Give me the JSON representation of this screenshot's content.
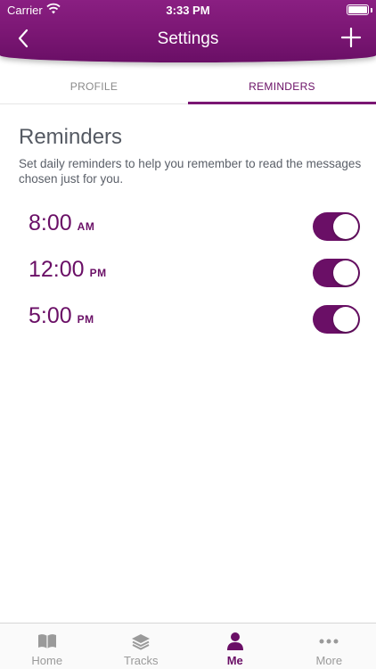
{
  "status_bar": {
    "carrier": "Carrier",
    "time": "3:33 PM"
  },
  "nav": {
    "title": "Settings",
    "back_icon": "chevron-left-icon",
    "add_icon": "plus-icon"
  },
  "tabs": [
    {
      "label": "PROFILE",
      "active": false
    },
    {
      "label": "REMINDERS",
      "active": true
    }
  ],
  "reminders_section": {
    "title": "Reminders",
    "description": "Set daily reminders to help you remember to read the messages chosen just for you."
  },
  "reminders": [
    {
      "time": "8:00",
      "period": "AM",
      "enabled": true
    },
    {
      "time": "12:00",
      "period": "PM",
      "enabled": true
    },
    {
      "time": "5:00",
      "period": "PM",
      "enabled": true
    }
  ],
  "tabbar": [
    {
      "label": "Home",
      "icon": "book-icon",
      "active": false
    },
    {
      "label": "Tracks",
      "icon": "layers-icon",
      "active": false
    },
    {
      "label": "Me",
      "icon": "person-icon",
      "active": true
    },
    {
      "label": "More",
      "icon": "more-icon",
      "active": false
    }
  ],
  "colors": {
    "brand": "#6a0f66",
    "text": "#555a63",
    "inactive": "#9a9a9a"
  }
}
